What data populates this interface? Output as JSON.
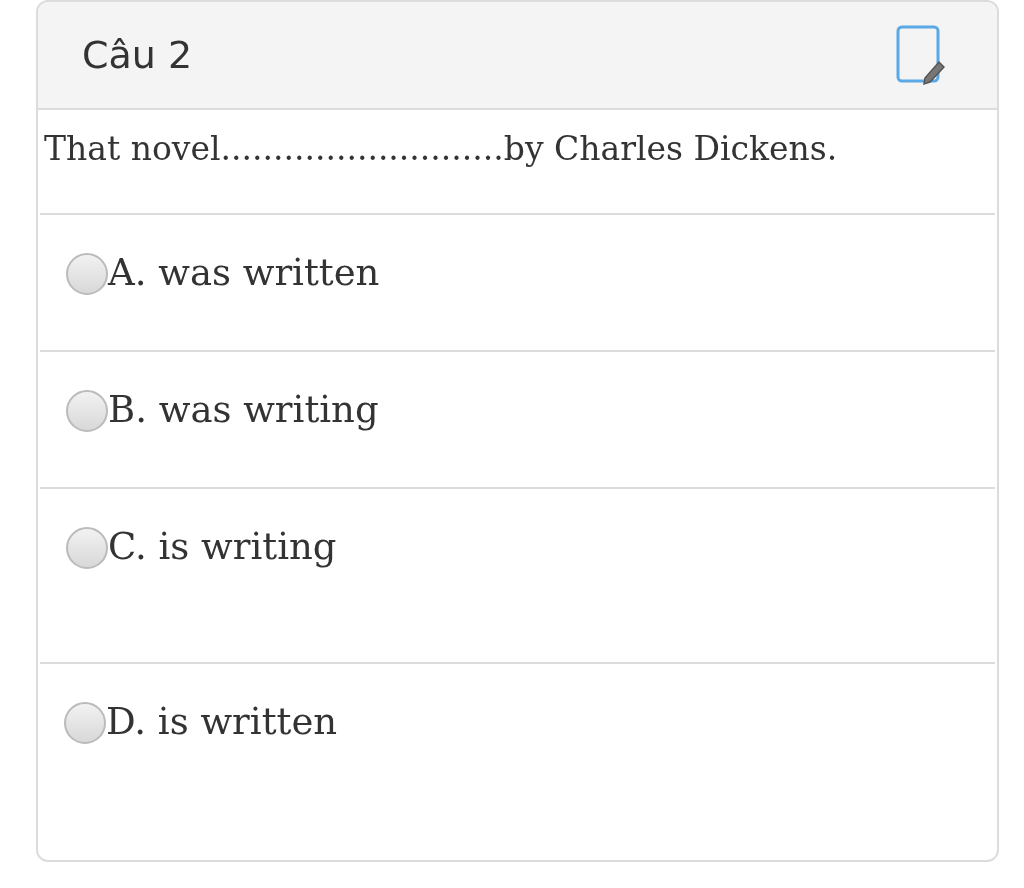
{
  "header": {
    "title": "Câu 2"
  },
  "question": "That novel...........................by Charles Dickens.",
  "options": [
    {
      "label": "A. was written",
      "selected": false
    },
    {
      "label": "B. was writing",
      "selected": false
    },
    {
      "label": "C. is writing",
      "selected": false
    },
    {
      "label": "D. is written",
      "selected": false
    }
  ]
}
